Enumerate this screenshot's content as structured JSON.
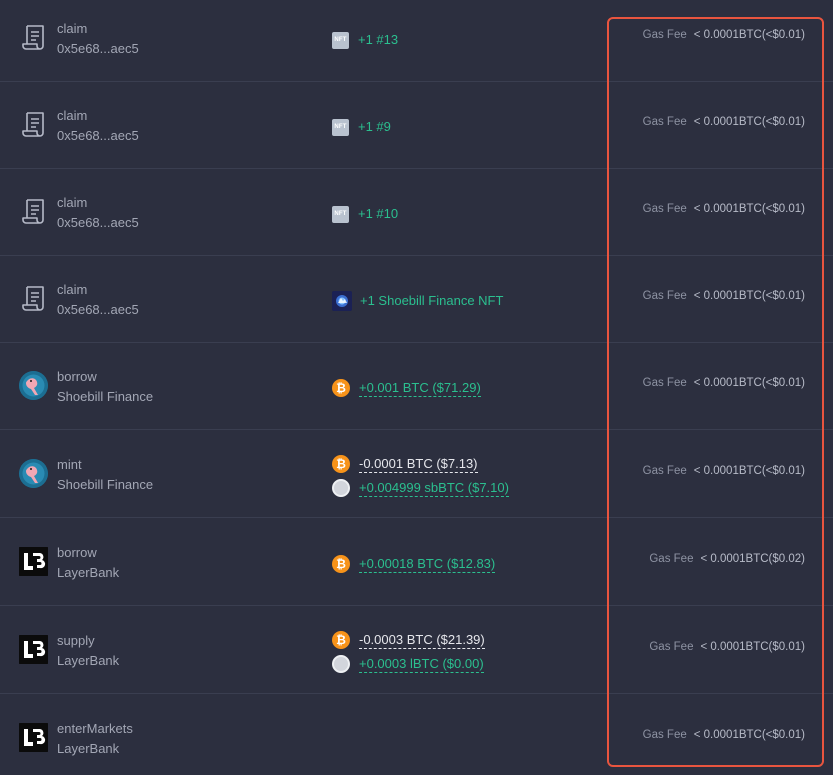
{
  "transactions": [
    {
      "method": "claim",
      "source": "0x5e68...aec5",
      "fee_label": "Gas Fee",
      "fee_value": "< 0.0001BTC(<$0.01)",
      "tokens": [
        {
          "icon": "nft-badge-icon",
          "icon_text": "NFT",
          "text": "+1 #13"
        }
      ]
    },
    {
      "method": "claim",
      "source": "0x5e68...aec5",
      "fee_label": "Gas Fee",
      "fee_value": "< 0.0001BTC(<$0.01)",
      "tokens": [
        {
          "icon": "nft-badge-icon",
          "icon_text": "NFT",
          "text": "+1 #9"
        }
      ]
    },
    {
      "method": "claim",
      "source": "0x5e68...aec5",
      "fee_label": "Gas Fee",
      "fee_value": "< 0.0001BTC(<$0.01)",
      "tokens": [
        {
          "icon": "nft-badge-icon",
          "icon_text": "NFT",
          "text": "+1 #10"
        }
      ]
    },
    {
      "method": "claim",
      "source": "0x5e68...aec5",
      "fee_label": "Gas Fee",
      "fee_value": "< 0.0001BTC(<$0.01)",
      "tokens": [
        {
          "icon": "shoebill-nft-icon",
          "text": "+1 Shoebill Finance NFT"
        }
      ]
    },
    {
      "method": "borrow",
      "source": "Shoebill Finance",
      "fee_label": "Gas Fee",
      "fee_value": "< 0.0001BTC(<$0.01)",
      "tokens": [
        {
          "icon": "btc-icon",
          "icon_text": "₿",
          "text": "+0.001 BTC ($71.29)"
        }
      ]
    },
    {
      "method": "mint",
      "source": "Shoebill Finance",
      "fee_label": "Gas Fee",
      "fee_value": "< 0.0001BTC(<$0.01)",
      "tokens": [
        {
          "icon": "btc-icon",
          "icon_text": "₿",
          "text": "-0.0001 BTC ($7.13)"
        },
        {
          "icon": "sbbtc-icon",
          "text": "+0.004999 sbBTC ($7.10)"
        }
      ]
    },
    {
      "method": "borrow",
      "source": "LayerBank",
      "fee_label": "Gas Fee",
      "fee_value": "< 0.0001BTC($0.02)",
      "tokens": [
        {
          "icon": "btc-icon",
          "icon_text": "₿",
          "text": "+0.00018 BTC ($12.83)"
        }
      ]
    },
    {
      "method": "supply",
      "source": "LayerBank",
      "fee_label": "Gas Fee",
      "fee_value": "< 0.0001BTC($0.01)",
      "tokens": [
        {
          "icon": "btc-icon",
          "icon_text": "₿",
          "text": "-0.0003 BTC ($21.39)"
        },
        {
          "icon": "lbtc-icon",
          "text": "+0.0003 lBTC ($0.00)"
        }
      ]
    },
    {
      "method": "enterMarkets",
      "source": "LayerBank",
      "fee_label": "Gas Fee",
      "fee_value": "< 0.0001BTC(<$0.01)",
      "tokens": []
    }
  ],
  "colors": {
    "background": "#2c2f3f",
    "positive": "#2bbf8f",
    "negative": "#e6e7ec",
    "highlight": "#e9553f"
  }
}
